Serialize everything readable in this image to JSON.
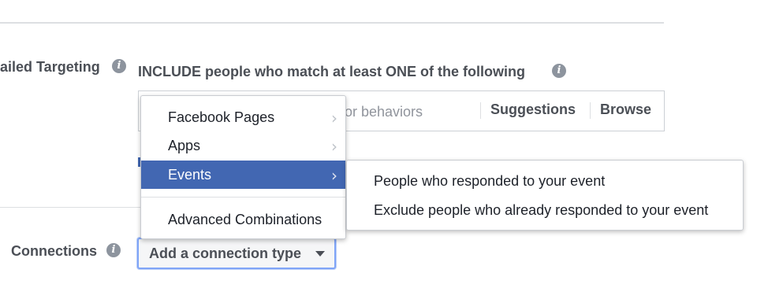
{
  "detailed_targeting": {
    "label": "ailed Targeting",
    "include_text": "INCLUDE people who match at least ONE of the following",
    "search_placeholder": "or behaviors",
    "suggestions_label": "Suggestions",
    "browse_label": "Browse"
  },
  "browse_menu": {
    "items": [
      {
        "label": "Facebook Pages",
        "has_submenu": true
      },
      {
        "label": "Apps",
        "has_submenu": true
      },
      {
        "label": "Events",
        "has_submenu": true,
        "active": true
      },
      {
        "label": "Advanced Combinations",
        "has_submenu": false
      }
    ],
    "chevron": "›"
  },
  "events_submenu": {
    "items": [
      {
        "label": "People who responded to your event"
      },
      {
        "label": "Exclude people who already responded to your event"
      }
    ]
  },
  "connections": {
    "label": "Connections",
    "dropdown_label": "Add a connection type"
  },
  "info_icon": "i",
  "colors": {
    "accent": "#4267b2",
    "focus_border": "#80a5f7",
    "label_text": "#4b4f56",
    "placeholder": "#90949c"
  }
}
